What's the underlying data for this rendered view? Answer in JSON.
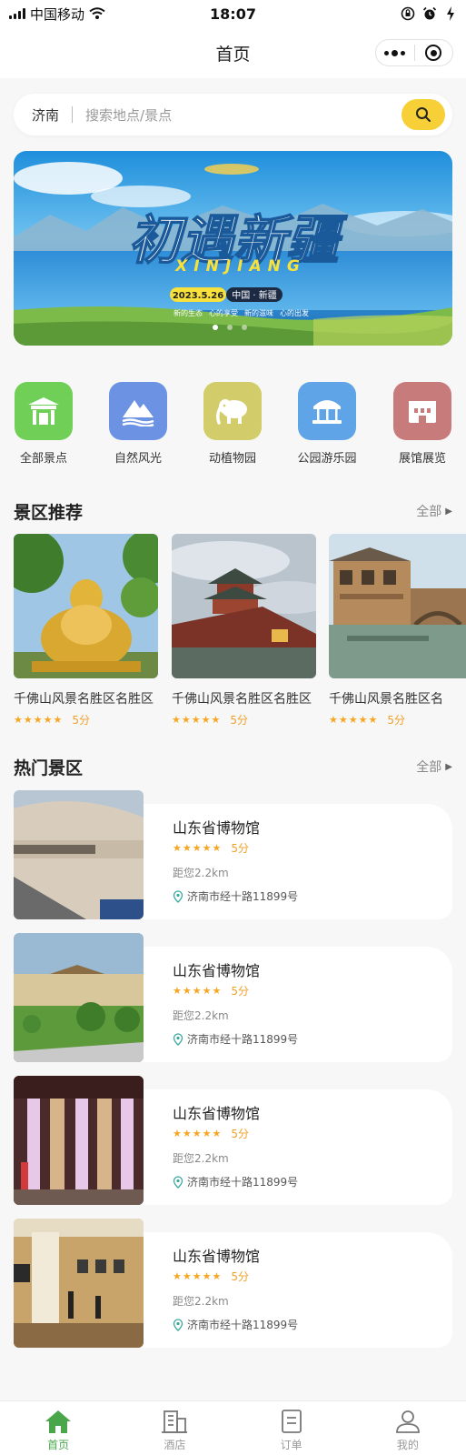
{
  "status": {
    "carrier": "中国移动",
    "time": "18:07",
    "wifi_icon": "wifi-icon",
    "right_icons": [
      "rotation-lock-icon",
      "alarm-icon",
      "charging-battery-icon"
    ]
  },
  "nav": {
    "title": "首页",
    "capsule": {
      "more_icon": "more-dots-icon",
      "close_icon": "close-target-icon"
    }
  },
  "search": {
    "city": "济南",
    "placeholder": "搜索地点/景点",
    "icon": "search-icon",
    "accent": "#f7cf36"
  },
  "banner": {
    "headline": "初遇新疆",
    "subtitle_en": "XINJIANG",
    "date": "2023.5.26",
    "location_tag": "中国 · 新疆",
    "slogans": [
      "新的生态",
      "心的享受",
      "新的滋味",
      "心的出发"
    ],
    "indicator_count": 3,
    "active_index": 0
  },
  "categories": [
    {
      "label": "全部景点",
      "icon": "pavilion-icon",
      "color": "#6fcf57"
    },
    {
      "label": "自然风光",
      "icon": "mountain-icon",
      "color": "#6c93e3"
    },
    {
      "label": "动植物园",
      "icon": "elephant-icon",
      "color": "#d2cc6a"
    },
    {
      "label": "公园游乐园",
      "icon": "carousel-icon",
      "color": "#5ea4e6"
    },
    {
      "label": "展馆展览",
      "icon": "museum-icon",
      "color": "#c77b7b"
    }
  ],
  "recommend": {
    "title": "景区推荐",
    "more": "全部",
    "items": [
      {
        "name": "千佛山风景名胜区名胜区",
        "score": "5分",
        "rating": 5
      },
      {
        "name": "千佛山风景名胜区名胜区",
        "score": "5分",
        "rating": 5
      },
      {
        "name": "千佛山风景名胜区名",
        "score": "5分",
        "rating": 5
      }
    ]
  },
  "hot": {
    "title": "热门景区",
    "more": "全部",
    "items": [
      {
        "name": "山东省博物馆",
        "score": "5分",
        "rating": 5,
        "distance": "距您2.2km",
        "address": "济南市经十路11899号"
      },
      {
        "name": "山东省博物馆",
        "score": "5分",
        "rating": 5,
        "distance": "距您2.2km",
        "address": "济南市经十路11899号"
      },
      {
        "name": "山东省博物馆",
        "score": "5分",
        "rating": 5,
        "distance": "距您2.2km",
        "address": "济南市经十路11899号"
      },
      {
        "name": "山东省博物馆",
        "score": "5分",
        "rating": 5,
        "distance": "距您2.2km",
        "address": "济南市经十路11899号"
      }
    ]
  },
  "stars_text": "★★★★★",
  "tabs": [
    {
      "label": "首页",
      "icon": "home-icon",
      "active": true
    },
    {
      "label": "酒店",
      "icon": "hotel-building-icon",
      "active": false
    },
    {
      "label": "订单",
      "icon": "order-document-icon",
      "active": false
    },
    {
      "label": "我的",
      "icon": "user-profile-icon",
      "active": false
    }
  ],
  "colors": {
    "brand_green": "#49a64a",
    "star": "#f6a623",
    "background": "#f7f7f7"
  }
}
